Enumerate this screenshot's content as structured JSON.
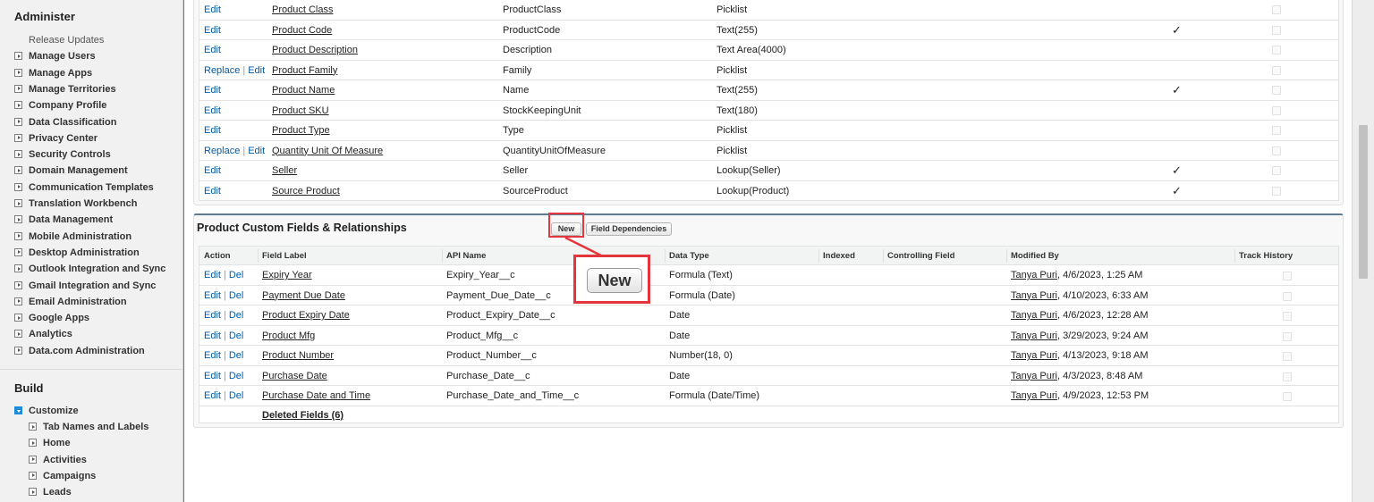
{
  "sidebar": {
    "administer_heading": "Administer",
    "administer_items": [
      {
        "label": "Release Updates",
        "expandable": false
      },
      {
        "label": "Manage Users",
        "expandable": true
      },
      {
        "label": "Manage Apps",
        "expandable": true
      },
      {
        "label": "Manage Territories",
        "expandable": true
      },
      {
        "label": "Company Profile",
        "expandable": true
      },
      {
        "label": "Data Classification",
        "expandable": true
      },
      {
        "label": "Privacy Center",
        "expandable": true
      },
      {
        "label": "Security Controls",
        "expandable": true
      },
      {
        "label": "Domain Management",
        "expandable": true
      },
      {
        "label": "Communication Templates",
        "expandable": true
      },
      {
        "label": "Translation Workbench",
        "expandable": true
      },
      {
        "label": "Data Management",
        "expandable": true
      },
      {
        "label": "Mobile Administration",
        "expandable": true
      },
      {
        "label": "Desktop Administration",
        "expandable": true
      },
      {
        "label": "Outlook Integration and Sync",
        "expandable": true
      },
      {
        "label": "Gmail Integration and Sync",
        "expandable": true
      },
      {
        "label": "Email Administration",
        "expandable": true
      },
      {
        "label": "Google Apps",
        "expandable": true
      },
      {
        "label": "Analytics",
        "expandable": true
      },
      {
        "label": "Data.com Administration",
        "expandable": true
      }
    ],
    "build_heading": "Build",
    "customize_label": "Customize",
    "customize_items": [
      "Tab Names and Labels",
      "Home",
      "Activities",
      "Campaigns",
      "Leads"
    ]
  },
  "standard_fields": {
    "rows": [
      {
        "action": "Edit",
        "replace": false,
        "label": "Product Class",
        "name": "ProductClass",
        "type": "Picklist",
        "indexed": false
      },
      {
        "action": "Edit",
        "replace": false,
        "label": "Product Code",
        "name": "ProductCode",
        "type": "Text(255)",
        "indexed": true
      },
      {
        "action": "Edit",
        "replace": false,
        "label": "Product Description",
        "name": "Description",
        "type": "Text Area(4000)",
        "indexed": false
      },
      {
        "action": "Edit",
        "replace": true,
        "label": "Product Family",
        "name": "Family",
        "type": "Picklist",
        "indexed": false
      },
      {
        "action": "Edit",
        "replace": false,
        "label": "Product Name",
        "name": "Name",
        "type": "Text(255)",
        "indexed": true
      },
      {
        "action": "Edit",
        "replace": false,
        "label": "Product SKU",
        "name": "StockKeepingUnit",
        "type": "Text(180)",
        "indexed": false
      },
      {
        "action": "Edit",
        "replace": false,
        "label": "Product Type",
        "name": "Type",
        "type": "Picklist",
        "indexed": false
      },
      {
        "action": "Edit",
        "replace": true,
        "label": "Quantity Unit Of Measure",
        "name": "QuantityUnitOfMeasure",
        "type": "Picklist",
        "indexed": false
      },
      {
        "action": "Edit",
        "replace": false,
        "label": "Seller",
        "name": "Seller",
        "type": "Lookup(Seller)",
        "indexed": true
      },
      {
        "action": "Edit",
        "replace": false,
        "label": "Source Product",
        "name": "SourceProduct",
        "type": "Lookup(Product)",
        "indexed": true
      }
    ],
    "replace_label": "Replace",
    "separator": "|",
    "check_glyph": "✓"
  },
  "custom_fields": {
    "title": "Product Custom Fields & Relationships",
    "new_button": "New",
    "field_dependencies_button": "Field Dependencies",
    "columns": [
      "Action",
      "Field Label",
      "API Name",
      "Data Type",
      "Indexed",
      "Controlling Field",
      "Modified By",
      "Track History"
    ],
    "edit_label": "Edit",
    "del_label": "Del",
    "separator": "|",
    "rows": [
      {
        "label": "Expiry Year",
        "api": "Expiry_Year__c",
        "type": "Formula (Text)",
        "modified_user": "Tanya Puri",
        "modified_date": ", 4/6/2023, 1:25 AM"
      },
      {
        "label": "Payment Due Date",
        "api": "Payment_Due_Date__c",
        "type": "Formula (Date)",
        "modified_user": "Tanya Puri",
        "modified_date": ", 4/10/2023, 6:33 AM"
      },
      {
        "label": "Product Expiry Date",
        "api": "Product_Expiry_Date__c",
        "type": "Date",
        "modified_user": "Tanya Puri",
        "modified_date": ", 4/6/2023, 12:28 AM"
      },
      {
        "label": "Product Mfg",
        "api": "Product_Mfg__c",
        "type": "Date",
        "modified_user": "Tanya Puri",
        "modified_date": ", 3/29/2023, 9:24 AM"
      },
      {
        "label": "Product Number",
        "api": "Product_Number__c",
        "type": "Number(18, 0)",
        "modified_user": "Tanya Puri",
        "modified_date": ", 4/13/2023, 9:18 AM"
      },
      {
        "label": "Purchase Date",
        "api": "Purchase_Date__c",
        "type": "Date",
        "modified_user": "Tanya Puri",
        "modified_date": ", 4/3/2023, 8:48 AM"
      },
      {
        "label": "Purchase Date and Time",
        "api": "Purchase_Date_and_Time__c",
        "type": "Formula (Date/Time)",
        "modified_user": "Tanya Puri",
        "modified_date": ", 4/9/2023, 12:53 PM"
      }
    ],
    "deleted_fields": "Deleted Fields (6)"
  },
  "callout": {
    "label": "New",
    "accent_color": "#e3363c"
  },
  "colors": {
    "link": "#015ba7",
    "header_border": "#5e7b95",
    "page_background": "#1798c1"
  }
}
